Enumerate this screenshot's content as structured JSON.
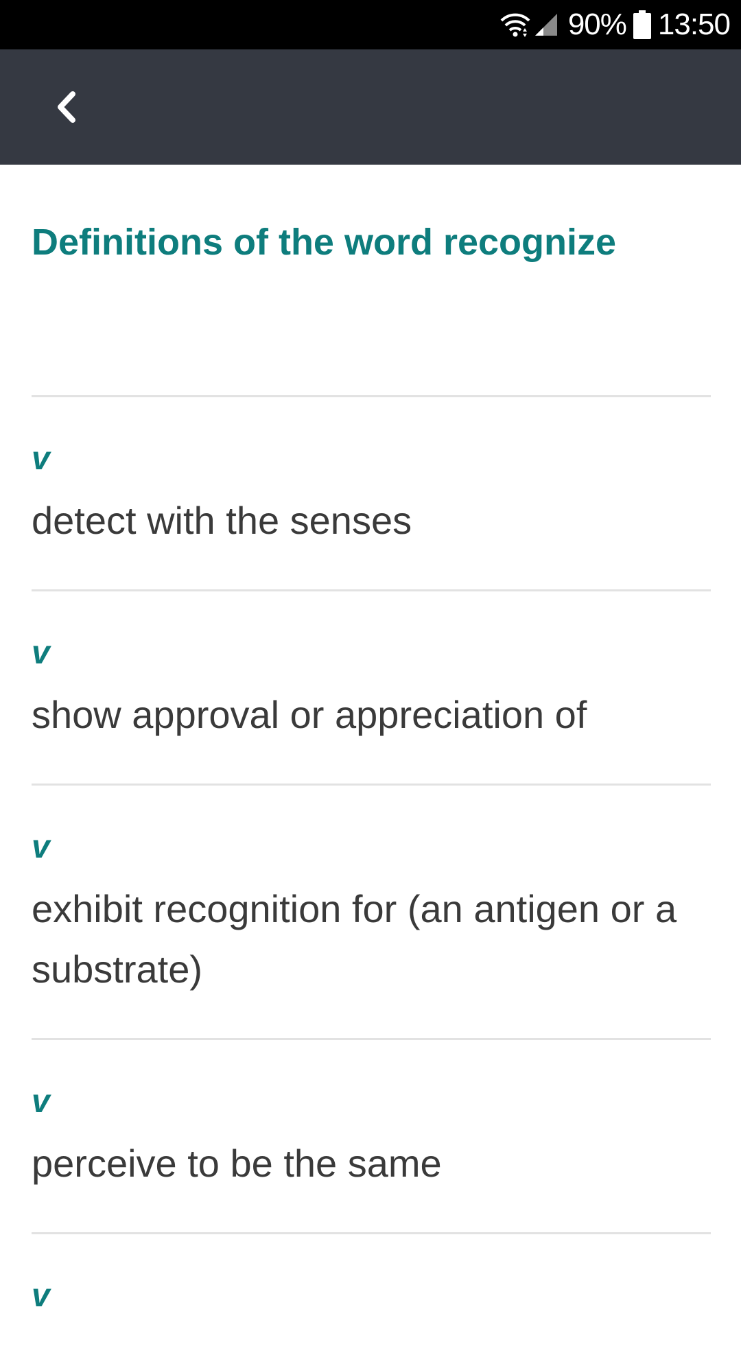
{
  "status_bar": {
    "battery_text": "90%",
    "time": "13:50",
    "icons": [
      "wifi-icon",
      "signal-icon",
      "battery-icon"
    ]
  },
  "app_bar": {
    "back_icon": "chevron-left-icon"
  },
  "main": {
    "title": "Definitions of the word recognize",
    "definitions": [
      {
        "pos": "v",
        "text": "detect with the senses"
      },
      {
        "pos": "v",
        "text": "show approval or appreciation of"
      },
      {
        "pos": "v",
        "text": "exhibit recognition for (an antigen or a substrate)"
      },
      {
        "pos": "v",
        "text": "perceive to be the same"
      },
      {
        "pos": "v",
        "text": ""
      }
    ]
  },
  "colors": {
    "status_bar": "#000000",
    "app_bar": "#353942",
    "accent": "#0e7d7d",
    "text": "#3a3a3a",
    "divider": "#e2e2e2"
  }
}
